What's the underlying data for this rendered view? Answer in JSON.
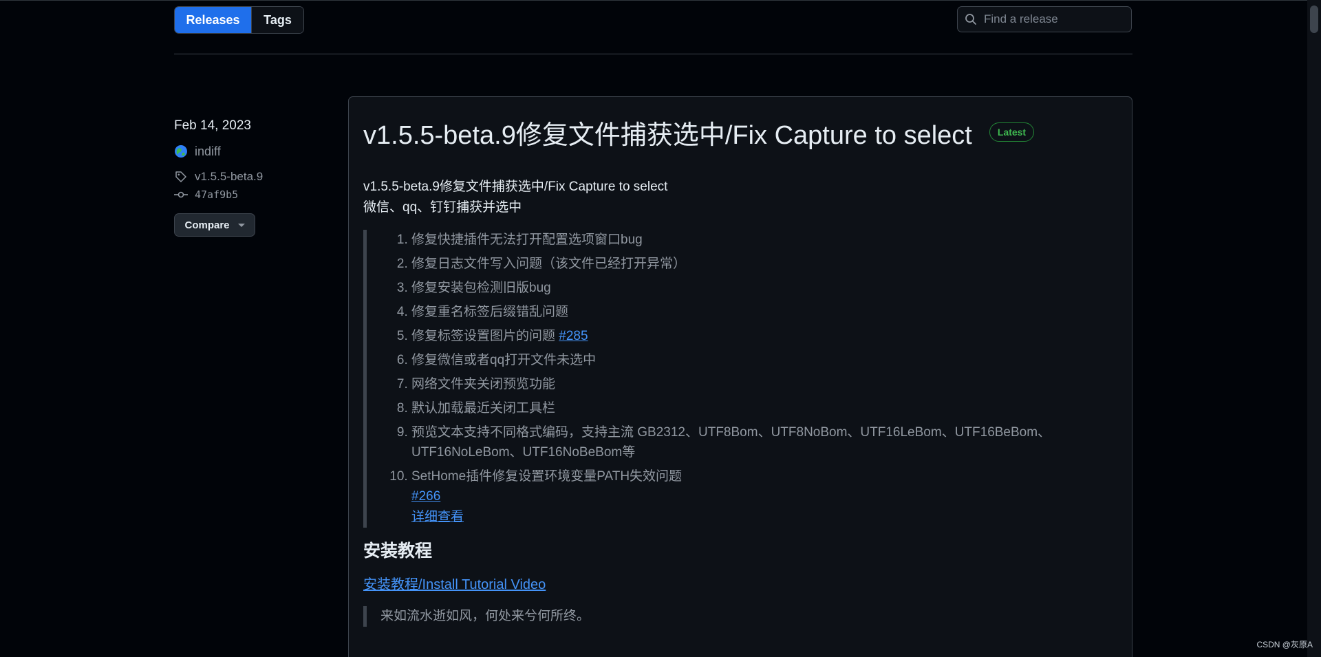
{
  "nav": {
    "releases_label": "Releases",
    "tags_label": "Tags",
    "search_placeholder": "Find a release"
  },
  "release": {
    "date": "Feb 14, 2023",
    "author": "indiff",
    "tag": "v1.5.5-beta.9",
    "commit": "47af9b5",
    "compare_label": "Compare",
    "title": "v1.5.5-beta.9修复文件捕获选中/Fix Capture to select",
    "badge": "Latest",
    "intro": "v1.5.5-beta.9修复文件捕获选中/Fix Capture to select",
    "subtitle": "微信、qq、钉钉捕获并选中",
    "items": [
      "修复快捷插件无法打开配置选项窗口bug",
      "修复日志文件写入问题（该文件已经打开异常）",
      "修复安装包检测旧版bug",
      "修复重名标签后缀错乱问题",
      "修复标签设置图片的问题",
      "修复微信或者qq打开文件未选中",
      "网络文件夹关闭预览功能",
      "默认加载最近关闭工具栏",
      "预览文本支持不同格式编码，支持主流 GB2312、UTF8Bom、UTF8NoBom、UTF16LeBom、UTF16BeBom、UTF16NoLeBom、UTF16NoBeBom等",
      "SetHome插件修复设置环境变量PATH失效问题"
    ],
    "item5_link": "#285",
    "item10_link": "#266",
    "item10_detail": "详细查看",
    "section_heading": "安装教程",
    "tutorial_link": "安装教程/Install Tutorial Video",
    "quote": "来如流水逝如风，何处来兮何所终。"
  },
  "watermark": "CSDN @灰原A",
  "colors": {
    "background": "#010409",
    "card": "#0d1117",
    "accent": "#1f6feb",
    "link": "#4493f8",
    "latest_badge": "#3fb950"
  }
}
